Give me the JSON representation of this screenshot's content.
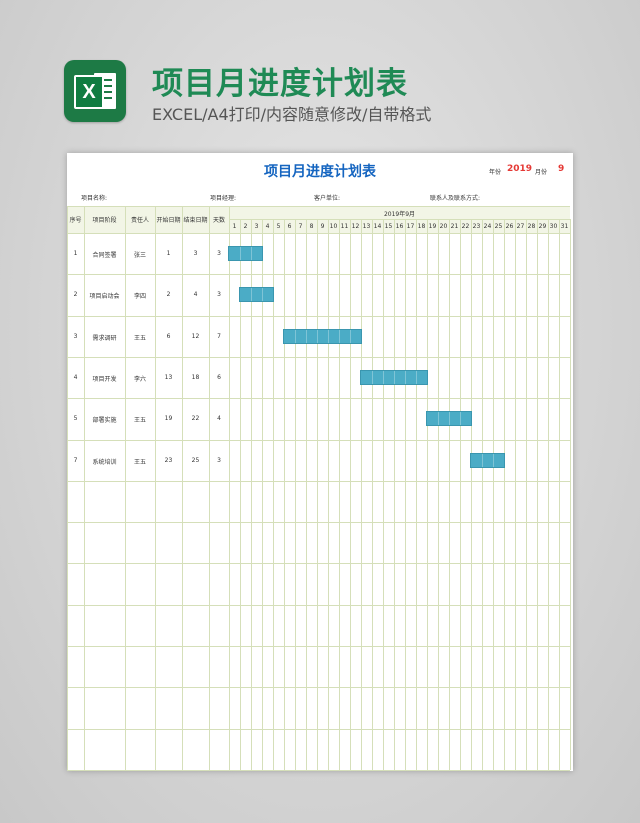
{
  "header": {
    "title": "项目月进度计划表",
    "subtitle": "EXCEL/A4打印/内容随意修改/自带格式",
    "logo_icon": "excel-icon",
    "logo_letter": "X"
  },
  "sheet": {
    "title": "项目月进度计划表",
    "year_label": "年份",
    "year": "2019",
    "month_label": "月份",
    "month": "9",
    "info_fields": [
      "项目名称:",
      "项目经理:",
      "客户单位:",
      "联系人及联系方式:"
    ],
    "columns": [
      "序号",
      "项目阶段",
      "责任人",
      "开始日期",
      "结束日期",
      "天数"
    ],
    "month_header": "2019年9月",
    "days": [
      "1",
      "2",
      "3",
      "4",
      "5",
      "6",
      "7",
      "8",
      "9",
      "10",
      "11",
      "12",
      "13",
      "14",
      "15",
      "16",
      "17",
      "18",
      "19",
      "20",
      "21",
      "22",
      "23",
      "24",
      "25",
      "26",
      "27",
      "28",
      "29",
      "30",
      "31"
    ],
    "rows": [
      {
        "no": "1",
        "stage": "合同签署",
        "owner": "张三",
        "start": "1",
        "end": "3",
        "days": "3"
      },
      {
        "no": "2",
        "stage": "项目启动会",
        "owner": "李四",
        "start": "2",
        "end": "4",
        "days": "3"
      },
      {
        "no": "3",
        "stage": "需求调研",
        "owner": "王五",
        "start": "6",
        "end": "12",
        "days": "7"
      },
      {
        "no": "4",
        "stage": "项目开发",
        "owner": "李六",
        "start": "13",
        "end": "18",
        "days": "6"
      },
      {
        "no": "5",
        "stage": "部署实施",
        "owner": "王五",
        "start": "19",
        "end": "22",
        "days": "4"
      },
      {
        "no": "7",
        "stage": "系统培训",
        "owner": "王五",
        "start": "23",
        "end": "25",
        "days": "3"
      }
    ],
    "colors": {
      "bar": "#4bacc6",
      "title": "#1565c0",
      "grid": "#d5dfb9",
      "accent": "#e53935"
    }
  }
}
